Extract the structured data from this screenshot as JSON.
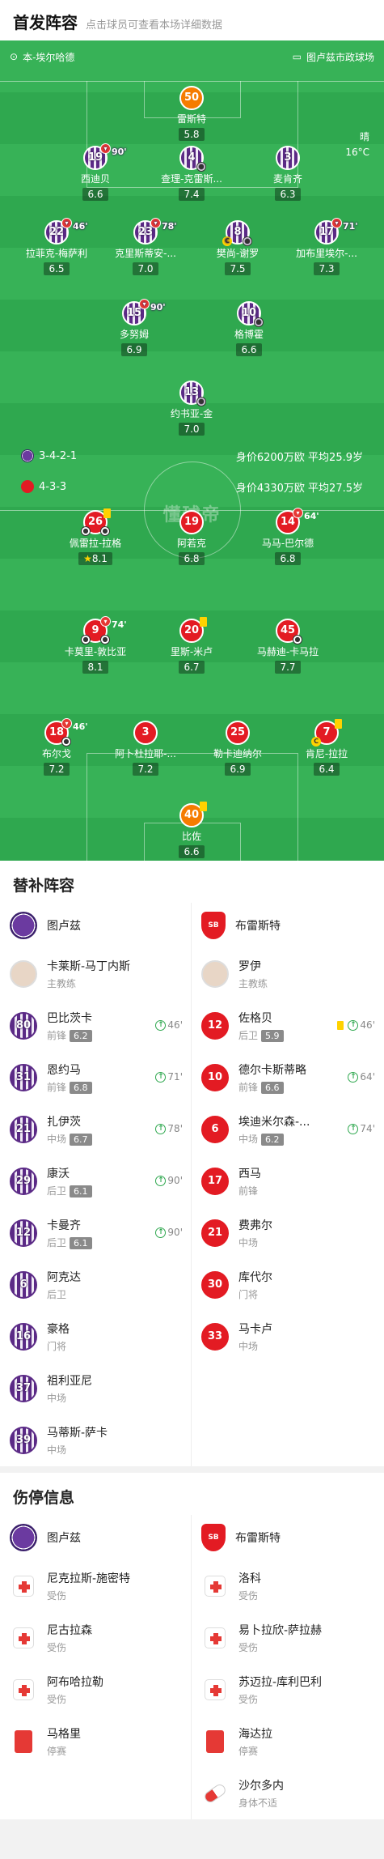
{
  "header": {
    "title": "首发阵容",
    "subtitle": "点击球员可查看本场详细数据"
  },
  "venue": {
    "referee": "本-埃尔哈德",
    "stadium": "图卢兹市政球场"
  },
  "weather": {
    "condition": "晴",
    "temp": "16°C"
  },
  "watermark": "懂球帝",
  "home": {
    "formation": "3-4-2-1",
    "value": "身价6200万欧 平均25.9岁",
    "players": [
      {
        "num": "50",
        "name": "雷斯特",
        "rating": "5.8",
        "gk": true
      },
      {
        "num": "19",
        "name": "西迪贝",
        "rating": "6.6",
        "sub": "90'"
      },
      {
        "num": "4",
        "name": "查理-克雷斯...",
        "rating": "7.4"
      },
      {
        "num": "3",
        "name": "麦肯齐",
        "rating": "6.3"
      },
      {
        "num": "22",
        "name": "拉菲克-梅萨利",
        "rating": "6.5",
        "sub": "46'"
      },
      {
        "num": "23",
        "name": "克里斯蒂安-...",
        "rating": "7.0",
        "sub": "78'"
      },
      {
        "num": "8",
        "name": "樊尚-谢罗",
        "rating": "7.5"
      },
      {
        "num": "17",
        "name": "加布里埃尔-...",
        "rating": "7.3",
        "sub": "71'"
      },
      {
        "num": "15",
        "name": "多努姆",
        "rating": "6.9",
        "sub": "90'"
      },
      {
        "num": "10",
        "name": "格博霍",
        "rating": "6.6"
      },
      {
        "num": "13",
        "name": "约书亚-金",
        "rating": "7.0"
      }
    ]
  },
  "away": {
    "formation": "4-3-3",
    "value": "身价4330万欧 平均27.5岁",
    "players": [
      {
        "num": "26",
        "name": "佩雷拉-拉格",
        "rating": "8.1"
      },
      {
        "num": "19",
        "name": "阿若克",
        "rating": "6.8"
      },
      {
        "num": "14",
        "name": "马马-巴尔德",
        "rating": "6.8",
        "sub": "64'"
      },
      {
        "num": "9",
        "name": "卡莫里-敦比亚",
        "rating": "8.1",
        "sub": "74'"
      },
      {
        "num": "20",
        "name": "里斯-米卢",
        "rating": "6.7"
      },
      {
        "num": "45",
        "name": "马赫迪-卡马拉",
        "rating": "7.7"
      },
      {
        "num": "18",
        "name": "布尔戈",
        "rating": "7.2",
        "sub": "46'"
      },
      {
        "num": "3",
        "name": "阿卜杜拉耶-...",
        "rating": "7.2"
      },
      {
        "num": "25",
        "name": "勒卡迪纳尔",
        "rating": "6.9"
      },
      {
        "num": "7",
        "name": "肯尼-拉拉",
        "rating": "6.4"
      },
      {
        "num": "40",
        "name": "比佐",
        "rating": "6.6",
        "gk": true
      }
    ]
  },
  "subs": {
    "title": "替补阵容",
    "home_team": "图卢兹",
    "away_team": "布雷斯特",
    "home": [
      {
        "num": "",
        "name": "卡莱斯-马丁内斯",
        "pos": "主教练",
        "coach": true
      },
      {
        "num": "80",
        "name": "巴比茨卡",
        "pos": "前锋",
        "rating": "6.2",
        "in": "46'"
      },
      {
        "num": "31",
        "name": "恩约马",
        "pos": "前锋",
        "rating": "6.8",
        "in": "71'"
      },
      {
        "num": "21",
        "name": "扎伊茨",
        "pos": "中场",
        "rating": "6.7",
        "in": "78'"
      },
      {
        "num": "29",
        "name": "康沃",
        "pos": "后卫",
        "rating": "6.1",
        "in": "90'"
      },
      {
        "num": "12",
        "name": "卡曼齐",
        "pos": "后卫",
        "rating": "6.1",
        "in": "90'"
      },
      {
        "num": "6",
        "name": "阿克达",
        "pos": "后卫"
      },
      {
        "num": "16",
        "name": "豪格",
        "pos": "门将"
      },
      {
        "num": "37",
        "name": "祖利亚尼",
        "pos": "中场"
      },
      {
        "num": "39",
        "name": "马蒂斯-萨卡",
        "pos": "中场"
      }
    ],
    "away": [
      {
        "num": "",
        "name": "罗伊",
        "pos": "主教练",
        "coach": true
      },
      {
        "num": "12",
        "name": "佐格贝",
        "pos": "后卫",
        "rating": "5.9",
        "in": "46'",
        "yellow": true
      },
      {
        "num": "10",
        "name": "德尔卡斯蒂略",
        "pos": "前锋",
        "rating": "6.6",
        "in": "64'"
      },
      {
        "num": "6",
        "name": "埃迪米尔森-...",
        "pos": "中场",
        "rating": "6.2",
        "in": "74'"
      },
      {
        "num": "17",
        "name": "西马",
        "pos": "前锋"
      },
      {
        "num": "21",
        "name": "费弗尔",
        "pos": "中场"
      },
      {
        "num": "30",
        "name": "库代尔",
        "pos": "门将"
      },
      {
        "num": "33",
        "name": "马卡卢",
        "pos": "中场"
      }
    ]
  },
  "injuries": {
    "title": "伤停信息",
    "home_team": "图卢兹",
    "away_team": "布雷斯特",
    "home": [
      {
        "name": "尼克拉斯-施密特",
        "status": "受伤",
        "kind": "injury"
      },
      {
        "name": "尼古拉森",
        "status": "受伤",
        "kind": "injury"
      },
      {
        "name": "阿布哈拉勒",
        "status": "受伤",
        "kind": "injury"
      },
      {
        "name": "马格里",
        "status": "停赛",
        "kind": "red"
      }
    ],
    "away": [
      {
        "name": "洛科",
        "status": "受伤",
        "kind": "injury"
      },
      {
        "name": "易卜拉欣-萨拉赫",
        "status": "受伤",
        "kind": "injury"
      },
      {
        "name": "苏迈拉-库利巴利",
        "status": "受伤",
        "kind": "injury"
      },
      {
        "name": "海达拉",
        "status": "停赛",
        "kind": "red"
      },
      {
        "name": "沙尔多内",
        "status": "身体不适",
        "kind": "ill"
      }
    ]
  }
}
